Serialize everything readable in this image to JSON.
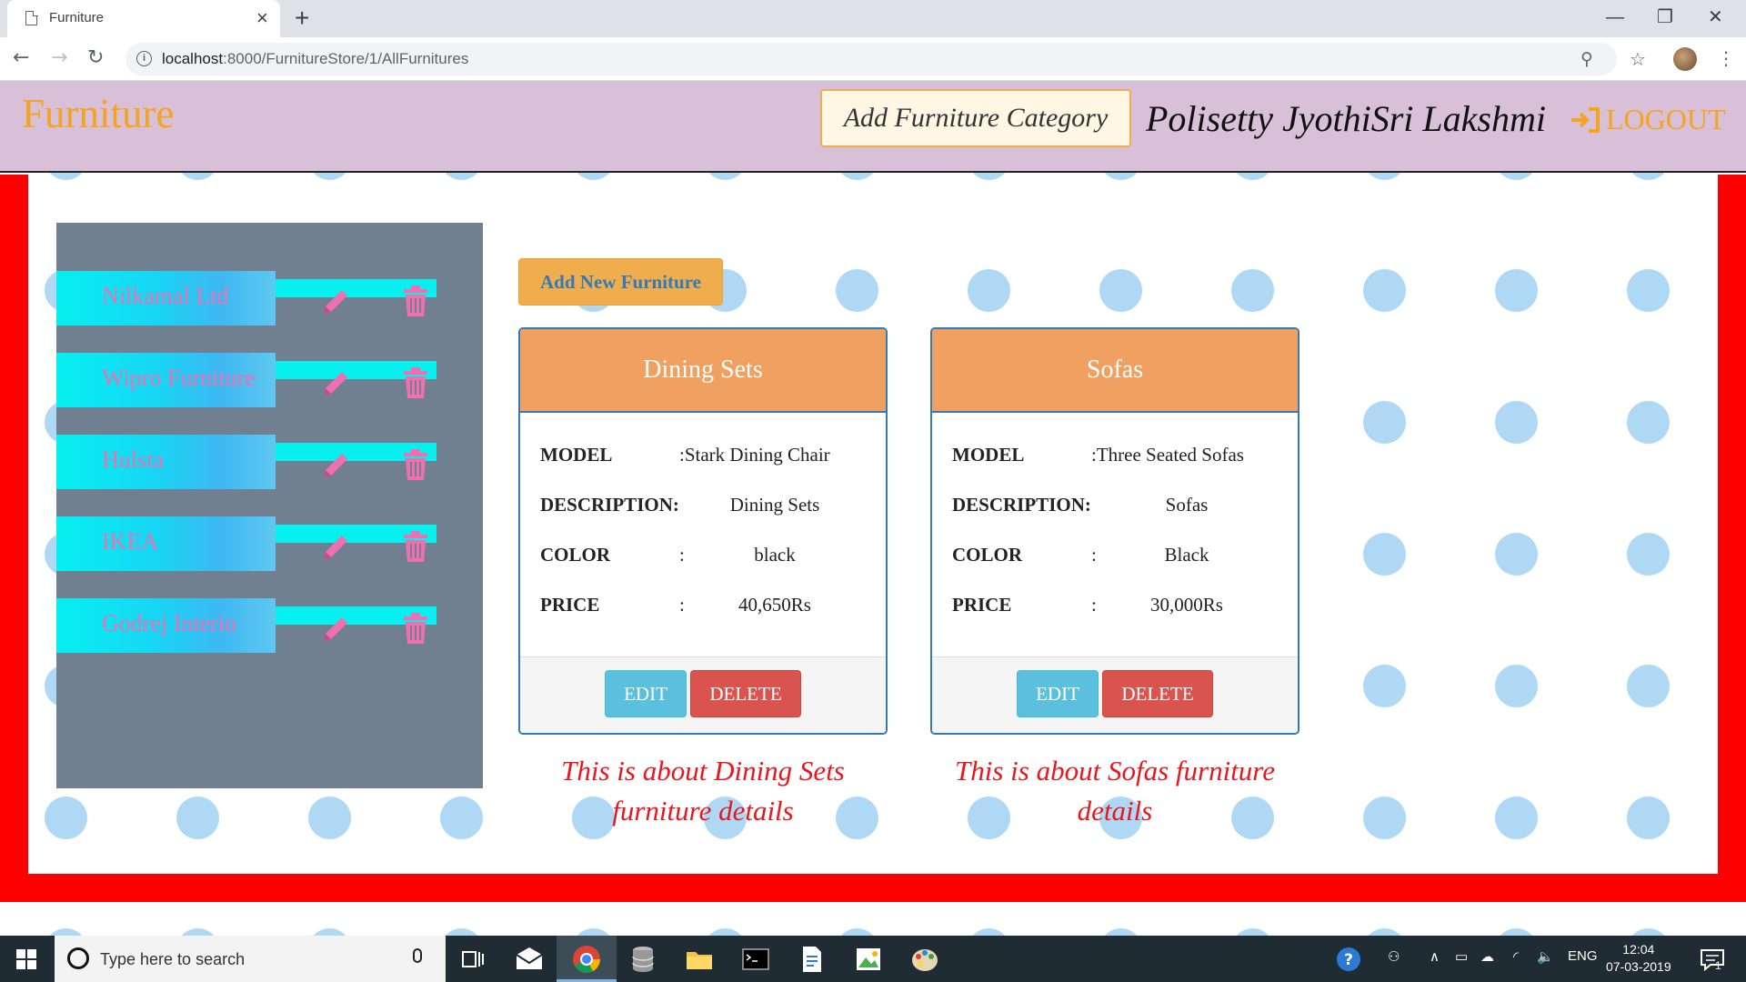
{
  "browser": {
    "tab_title": "Furniture",
    "tab_close": "×",
    "new_tab": "+",
    "url_host": "localhost",
    "url_path": ":8000/FurnitureStore/1/AllFurnitures",
    "window_controls": {
      "minimize": "—",
      "maximize": "❐",
      "close": "✕"
    }
  },
  "navbar": {
    "brand": "Furniture",
    "add_category_label": "Add Furniture Category",
    "user_name": "Polisetty JyothiSri Lakshmi",
    "logout_label": "LOGOUT"
  },
  "sidebar": {
    "items": [
      {
        "label": "Nilkamal Ltd"
      },
      {
        "label": "Wipro Furniture"
      },
      {
        "label": "Hulsta"
      },
      {
        "label": "IKEA"
      },
      {
        "label": "Godrej Interio"
      }
    ]
  },
  "content": {
    "add_furniture_label": "Add New Furniture",
    "field_labels": {
      "model": "MODEL",
      "description": "DESCRIPTION",
      "color": "COLOR",
      "price": "PRICE"
    },
    "edit_label": "EDIT",
    "delete_label": "DELETE",
    "cards": [
      {
        "title": "Dining Sets",
        "model": ":Stark Dining Chair",
        "description_sep": ":",
        "description": "Dining Sets",
        "color_sep": ":",
        "color": "black",
        "price_sep": ":",
        "price": "40,650Rs",
        "caption": "This is about Dining Sets furniture details"
      },
      {
        "title": "Sofas",
        "model": ":Three Seated Sofas",
        "description_sep": ":",
        "description": "Sofas",
        "color_sep": ":",
        "color": "Black",
        "price_sep": ":",
        "price": "30,000Rs",
        "caption": "This is about Sofas furniture details"
      }
    ]
  },
  "colors": {
    "brand": "#f5a320",
    "navbar_bg": "#d8c0d9",
    "frame_red": "#ff0000",
    "sidebar_bg": "#708090",
    "card_header": "#f0a060",
    "caption_red": "#e8171e",
    "edit_blue": "#5bc0de",
    "delete_red": "#d9534f"
  },
  "taskbar": {
    "search_placeholder": "Type here to search",
    "language": "ENG",
    "time": "12:04",
    "date": "07-03-2019",
    "notification_count": "1"
  }
}
